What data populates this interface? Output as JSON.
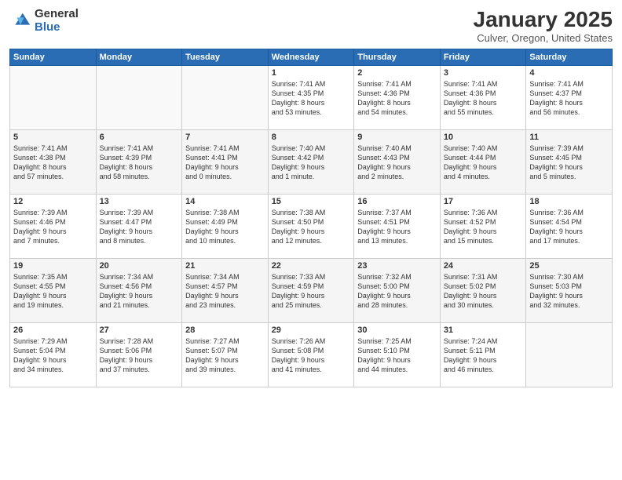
{
  "logo": {
    "general": "General",
    "blue": "Blue"
  },
  "header": {
    "title": "January 2025",
    "location": "Culver, Oregon, United States"
  },
  "weekdays": [
    "Sunday",
    "Monday",
    "Tuesday",
    "Wednesday",
    "Thursday",
    "Friday",
    "Saturday"
  ],
  "weeks": [
    [
      {
        "day": "",
        "info": ""
      },
      {
        "day": "",
        "info": ""
      },
      {
        "day": "",
        "info": ""
      },
      {
        "day": "1",
        "info": "Sunrise: 7:41 AM\nSunset: 4:35 PM\nDaylight: 8 hours\nand 53 minutes."
      },
      {
        "day": "2",
        "info": "Sunrise: 7:41 AM\nSunset: 4:36 PM\nDaylight: 8 hours\nand 54 minutes."
      },
      {
        "day": "3",
        "info": "Sunrise: 7:41 AM\nSunset: 4:36 PM\nDaylight: 8 hours\nand 55 minutes."
      },
      {
        "day": "4",
        "info": "Sunrise: 7:41 AM\nSunset: 4:37 PM\nDaylight: 8 hours\nand 56 minutes."
      }
    ],
    [
      {
        "day": "5",
        "info": "Sunrise: 7:41 AM\nSunset: 4:38 PM\nDaylight: 8 hours\nand 57 minutes."
      },
      {
        "day": "6",
        "info": "Sunrise: 7:41 AM\nSunset: 4:39 PM\nDaylight: 8 hours\nand 58 minutes."
      },
      {
        "day": "7",
        "info": "Sunrise: 7:41 AM\nSunset: 4:41 PM\nDaylight: 9 hours\nand 0 minutes."
      },
      {
        "day": "8",
        "info": "Sunrise: 7:40 AM\nSunset: 4:42 PM\nDaylight: 9 hours\nand 1 minute."
      },
      {
        "day": "9",
        "info": "Sunrise: 7:40 AM\nSunset: 4:43 PM\nDaylight: 9 hours\nand 2 minutes."
      },
      {
        "day": "10",
        "info": "Sunrise: 7:40 AM\nSunset: 4:44 PM\nDaylight: 9 hours\nand 4 minutes."
      },
      {
        "day": "11",
        "info": "Sunrise: 7:39 AM\nSunset: 4:45 PM\nDaylight: 9 hours\nand 5 minutes."
      }
    ],
    [
      {
        "day": "12",
        "info": "Sunrise: 7:39 AM\nSunset: 4:46 PM\nDaylight: 9 hours\nand 7 minutes."
      },
      {
        "day": "13",
        "info": "Sunrise: 7:39 AM\nSunset: 4:47 PM\nDaylight: 9 hours\nand 8 minutes."
      },
      {
        "day": "14",
        "info": "Sunrise: 7:38 AM\nSunset: 4:49 PM\nDaylight: 9 hours\nand 10 minutes."
      },
      {
        "day": "15",
        "info": "Sunrise: 7:38 AM\nSunset: 4:50 PM\nDaylight: 9 hours\nand 12 minutes."
      },
      {
        "day": "16",
        "info": "Sunrise: 7:37 AM\nSunset: 4:51 PM\nDaylight: 9 hours\nand 13 minutes."
      },
      {
        "day": "17",
        "info": "Sunrise: 7:36 AM\nSunset: 4:52 PM\nDaylight: 9 hours\nand 15 minutes."
      },
      {
        "day": "18",
        "info": "Sunrise: 7:36 AM\nSunset: 4:54 PM\nDaylight: 9 hours\nand 17 minutes."
      }
    ],
    [
      {
        "day": "19",
        "info": "Sunrise: 7:35 AM\nSunset: 4:55 PM\nDaylight: 9 hours\nand 19 minutes."
      },
      {
        "day": "20",
        "info": "Sunrise: 7:34 AM\nSunset: 4:56 PM\nDaylight: 9 hours\nand 21 minutes."
      },
      {
        "day": "21",
        "info": "Sunrise: 7:34 AM\nSunset: 4:57 PM\nDaylight: 9 hours\nand 23 minutes."
      },
      {
        "day": "22",
        "info": "Sunrise: 7:33 AM\nSunset: 4:59 PM\nDaylight: 9 hours\nand 25 minutes."
      },
      {
        "day": "23",
        "info": "Sunrise: 7:32 AM\nSunset: 5:00 PM\nDaylight: 9 hours\nand 28 minutes."
      },
      {
        "day": "24",
        "info": "Sunrise: 7:31 AM\nSunset: 5:02 PM\nDaylight: 9 hours\nand 30 minutes."
      },
      {
        "day": "25",
        "info": "Sunrise: 7:30 AM\nSunset: 5:03 PM\nDaylight: 9 hours\nand 32 minutes."
      }
    ],
    [
      {
        "day": "26",
        "info": "Sunrise: 7:29 AM\nSunset: 5:04 PM\nDaylight: 9 hours\nand 34 minutes."
      },
      {
        "day": "27",
        "info": "Sunrise: 7:28 AM\nSunset: 5:06 PM\nDaylight: 9 hours\nand 37 minutes."
      },
      {
        "day": "28",
        "info": "Sunrise: 7:27 AM\nSunset: 5:07 PM\nDaylight: 9 hours\nand 39 minutes."
      },
      {
        "day": "29",
        "info": "Sunrise: 7:26 AM\nSunset: 5:08 PM\nDaylight: 9 hours\nand 41 minutes."
      },
      {
        "day": "30",
        "info": "Sunrise: 7:25 AM\nSunset: 5:10 PM\nDaylight: 9 hours\nand 44 minutes."
      },
      {
        "day": "31",
        "info": "Sunrise: 7:24 AM\nSunset: 5:11 PM\nDaylight: 9 hours\nand 46 minutes."
      },
      {
        "day": "",
        "info": ""
      }
    ]
  ]
}
